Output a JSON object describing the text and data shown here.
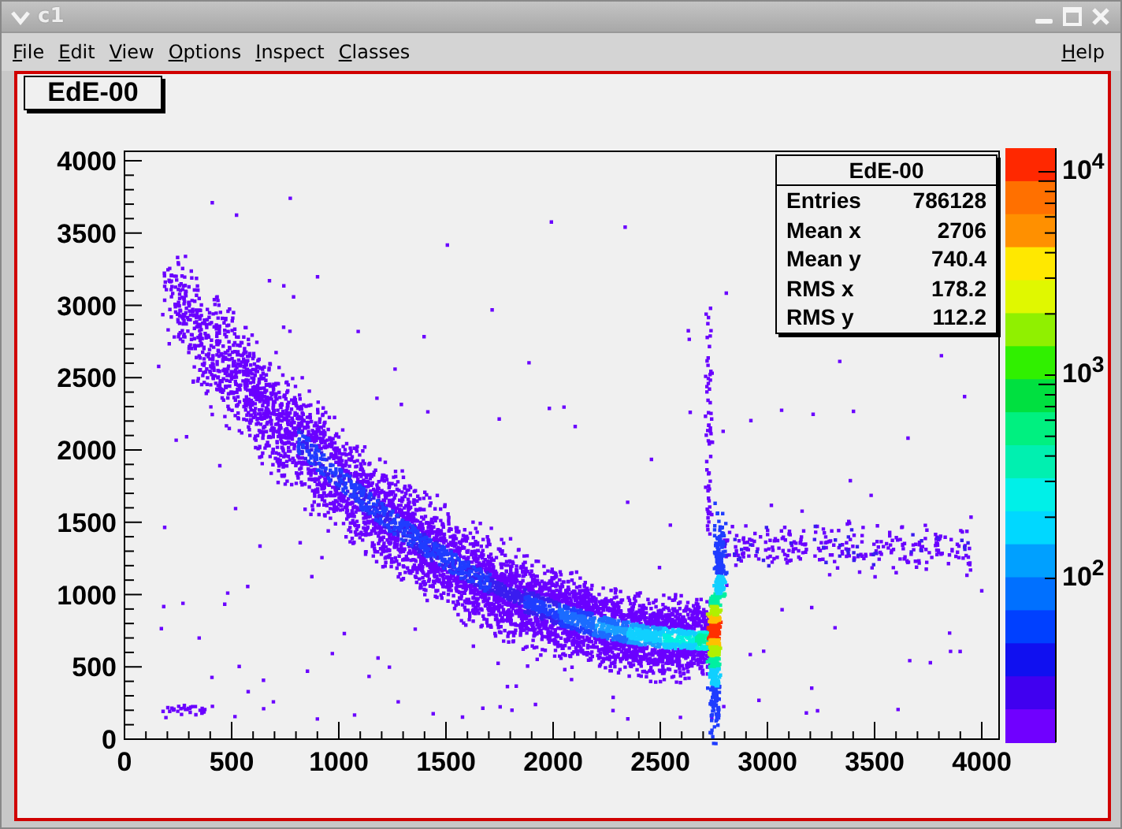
{
  "window": {
    "title": "c1"
  },
  "menu": [
    {
      "label": "File"
    },
    {
      "label": "Edit"
    },
    {
      "label": "View"
    },
    {
      "label": "Options"
    },
    {
      "label": "Inspect"
    },
    {
      "label": "Classes"
    }
  ],
  "help_menu": {
    "label": "Help"
  },
  "canvas": {
    "title": "EdE-00",
    "stats": {
      "title": "EdE-00",
      "rows": [
        {
          "name": "Entries",
          "value": "786128"
        },
        {
          "name": "Mean x",
          "value": "2706"
        },
        {
          "name": "Mean y",
          "value": "740.4"
        },
        {
          "name": "RMS x",
          "value": "178.2"
        },
        {
          "name": "RMS y",
          "value": "112.2"
        }
      ]
    },
    "xaxis": {
      "ticks": [
        "0",
        "500",
        "1000",
        "1500",
        "2000",
        "2500",
        "3000",
        "3500",
        "4000"
      ]
    },
    "yaxis": {
      "ticks": [
        "4000",
        "3500",
        "3000",
        "2500",
        "2000",
        "1500",
        "1000",
        "500",
        "0"
      ]
    },
    "palette": {
      "labels": [
        "10$^{4}$",
        "10$^{3}$",
        "10$^{2}$"
      ]
    }
  }
}
